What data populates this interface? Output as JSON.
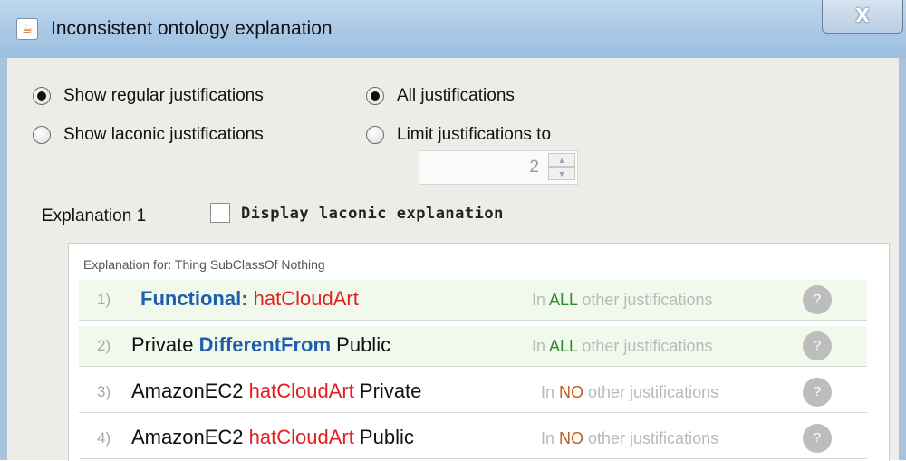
{
  "window": {
    "title": "Inconsistent ontology explanation",
    "close_label": "X"
  },
  "options": {
    "show_regular": "Show regular justifications",
    "show_laconic": "Show laconic justifications",
    "all_justifications": "All justifications",
    "limit_justifications": "Limit justifications to",
    "limit_value": "2",
    "selected_view": "Show regular justifications",
    "selected_limit": "All justifications"
  },
  "explanation": {
    "label": "Explanation 1",
    "laconic_checkbox": "Display laconic explanation",
    "laconic_checked": false,
    "header": "Explanation for: Thing SubClassOf Nothing"
  },
  "rows": [
    {
      "num": "1)",
      "p1": "",
      "kw": "Functional:",
      "prop": "hatCloudArt",
      "p2": "",
      "n1": "In ",
      "n2": "ALL",
      "n3": " other justifications",
      "highlight": true
    },
    {
      "num": "2)",
      "p1": "Private ",
      "kw": "DifferentFrom",
      "prop": "",
      "p2": " Public",
      "n1": "In ",
      "n2": "ALL",
      "n3": " other justifications",
      "highlight": true
    },
    {
      "num": "3)",
      "p1": "AmazonEC2 ",
      "kw": "",
      "prop": "hatCloudArt",
      "p2": " Private",
      "n1": "In ",
      "n2": "NO",
      "n3": " other justifications",
      "highlight": false
    },
    {
      "num": "4)",
      "p1": "AmazonEC2 ",
      "kw": "",
      "prop": "hatCloudArt",
      "p2": " Public",
      "n1": "In ",
      "n2": "NO",
      "n3": " other justifications",
      "highlight": false
    }
  ],
  "help_label": "?",
  "colors": {
    "keyword": "#1f5fae",
    "property": "#e32020",
    "all": "#2e8b2e",
    "no": "#c0601a",
    "highlight_row": "#f1f9ec"
  }
}
